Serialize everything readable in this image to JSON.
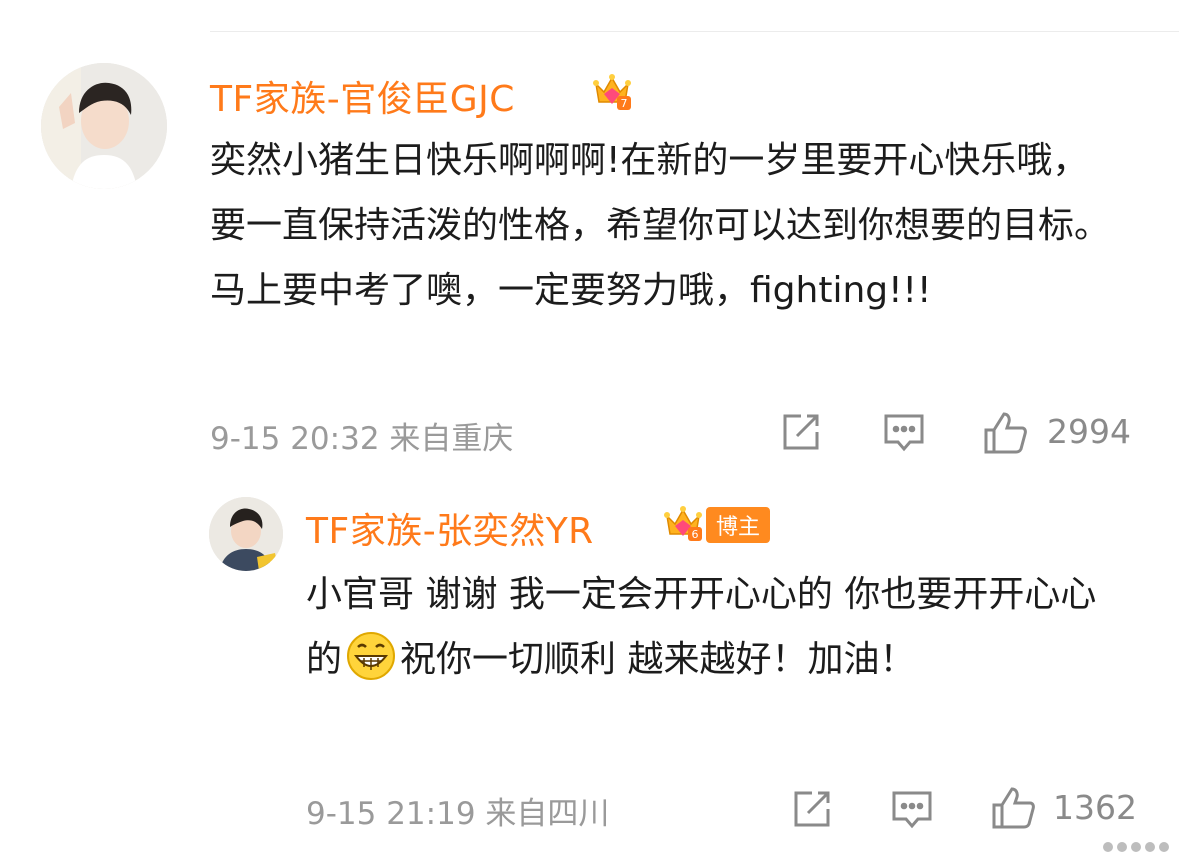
{
  "comment": {
    "username": "TF家族-官俊臣GJC",
    "text": "奕然小猪生日快乐啊啊啊!在新的一岁里要开心快乐哦，要一直保持活泼的性格，希望你可以达到你想要的目标。马上要中考了噢，一定要努力哦，fighting!!!",
    "meta": "9-15 20:32 来自重庆",
    "likes": "2994",
    "crown_level": "7"
  },
  "reply": {
    "username": "TF家族-张奕然YR",
    "tag": "博主",
    "text_before_emoji": "小官哥 谢谢 我一定会开开心心的 你也要开开心心的",
    "text_after_emoji": "祝你一切顺利 越来越好！加油！",
    "meta": "9-15 21:19 来自四川",
    "likes": "1362",
    "crown_level": "6"
  },
  "colors": {
    "username": "#ff7a1a",
    "meta": "#9a9a9a",
    "tag_bg": "#ff8a1f"
  },
  "icons": [
    "share-icon",
    "comment-icon",
    "like-icon",
    "grin-emoji",
    "crown-badge-icon"
  ]
}
